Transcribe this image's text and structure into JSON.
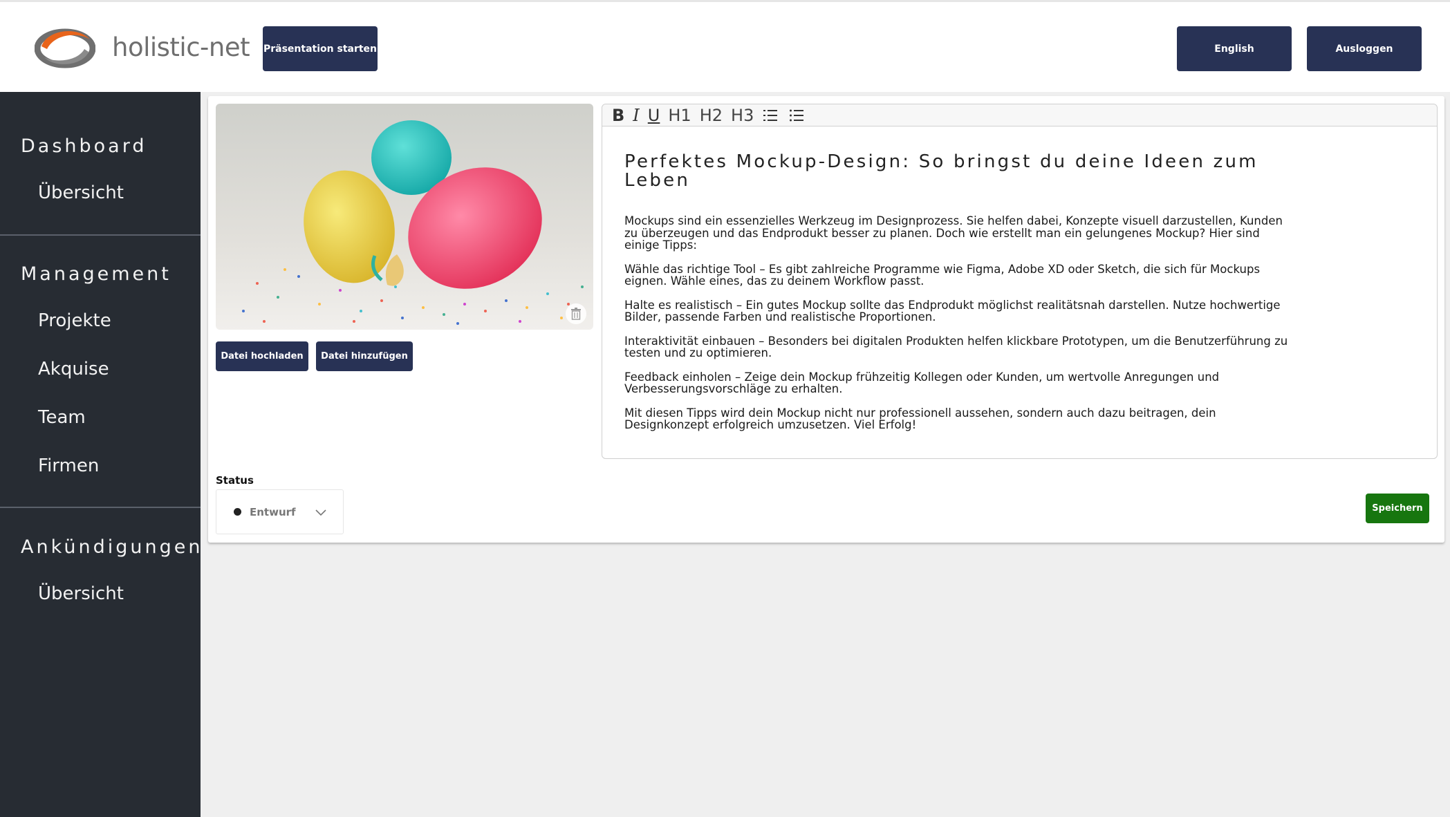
{
  "header": {
    "logo_text": "holistic-net",
    "present_button": "Präsentation starten",
    "language_button": "English",
    "logout_button": "Ausloggen"
  },
  "sidebar": {
    "sections": [
      {
        "heading": "Dashboard",
        "items": [
          "Übersicht"
        ]
      },
      {
        "heading": "Management",
        "items": [
          "Projekte",
          "Akquise",
          "Team",
          "Firmen"
        ]
      },
      {
        "heading": "Ankündigungen",
        "items": [
          "Übersicht"
        ]
      }
    ]
  },
  "media": {
    "upload_button": "Datei hochladen",
    "add_button": "Datei hinzufügen",
    "delete_icon": "trash-icon"
  },
  "editor": {
    "toolbar": {
      "bold": "B",
      "italic": "I",
      "underline": "U",
      "h1": "H1",
      "h2": "H2",
      "h3": "H3",
      "ordered_list_icon": "ordered-list-icon",
      "bullet_list_icon": "bullet-list-icon"
    },
    "title": "Perfektes Mockup-Design: So bringst du deine Ideen zum Leben",
    "paragraphs": [
      "Mockups sind ein essenzielles Werkzeug im Designprozess. Sie helfen dabei, Konzepte visuell darzustellen, Kunden zu überzeugen und das Endprodukt besser zu planen. Doch wie erstellt man ein gelungenes Mockup? Hier sind einige Tipps:",
      "Wähle das richtige Tool – Es gibt zahlreiche Programme wie Figma, Adobe XD oder Sketch, die sich für Mockups eignen. Wähle eines, das zu deinem Workflow passt.",
      "Halte es realistisch – Ein gutes Mockup sollte das Endprodukt möglichst realitätsnah darstellen. Nutze hochwertige Bilder, passende Farben und realistische Proportionen.",
      "Interaktivität einbauen – Besonders bei digitalen Produkten helfen klickbare Prototypen, um die Benutzerführung zu testen und zu optimieren.",
      "Feedback einholen – Zeige dein Mockup frühzeitig Kollegen oder Kunden, um wertvolle Anregungen und Verbesserungsvorschläge zu erhalten.",
      "Mit diesen Tipps wird dein Mockup nicht nur professionell aussehen, sondern auch dazu beitragen, dein Designkonzept erfolgreich umzusetzen. Viel Erfolg!"
    ]
  },
  "status": {
    "label": "Status",
    "selected": "Entwurf"
  },
  "save_button": "Speichern",
  "colors": {
    "primary_button": "#283255",
    "sidebar_bg": "#272c33",
    "save_button": "#17760f",
    "logo_orange": "#e8641b",
    "logo_gray": "#6f6f6f"
  }
}
